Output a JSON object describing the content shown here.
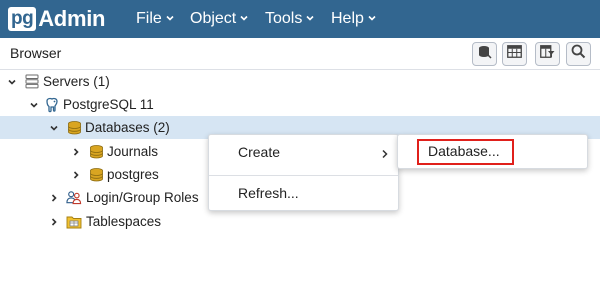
{
  "app": {
    "logo_prefix": "pg",
    "logo_suffix": "Admin",
    "brand_color": "#326690"
  },
  "menubar": {
    "items": [
      {
        "label": "File"
      },
      {
        "label": "Object"
      },
      {
        "label": "Tools"
      },
      {
        "label": "Help"
      }
    ]
  },
  "browser": {
    "title": "Browser",
    "toolbar_icons": [
      "query-tool-icon",
      "view-data-icon",
      "filtered-rows-icon",
      "search-icon"
    ]
  },
  "tree": {
    "servers": "Servers (1)",
    "server": "PostgreSQL 11",
    "databases": "Databases (2)",
    "db1": "Journals",
    "db2": "postgres",
    "login_roles": "Login/Group Roles",
    "tablespaces": "Tablespaces"
  },
  "context_menu": {
    "create": "Create",
    "refresh": "Refresh..."
  },
  "submenu": {
    "database": "Database..."
  },
  "colors": {
    "selection": "#d6e5f3",
    "highlight": "#e0201b",
    "db_icon": "#d9a521"
  }
}
